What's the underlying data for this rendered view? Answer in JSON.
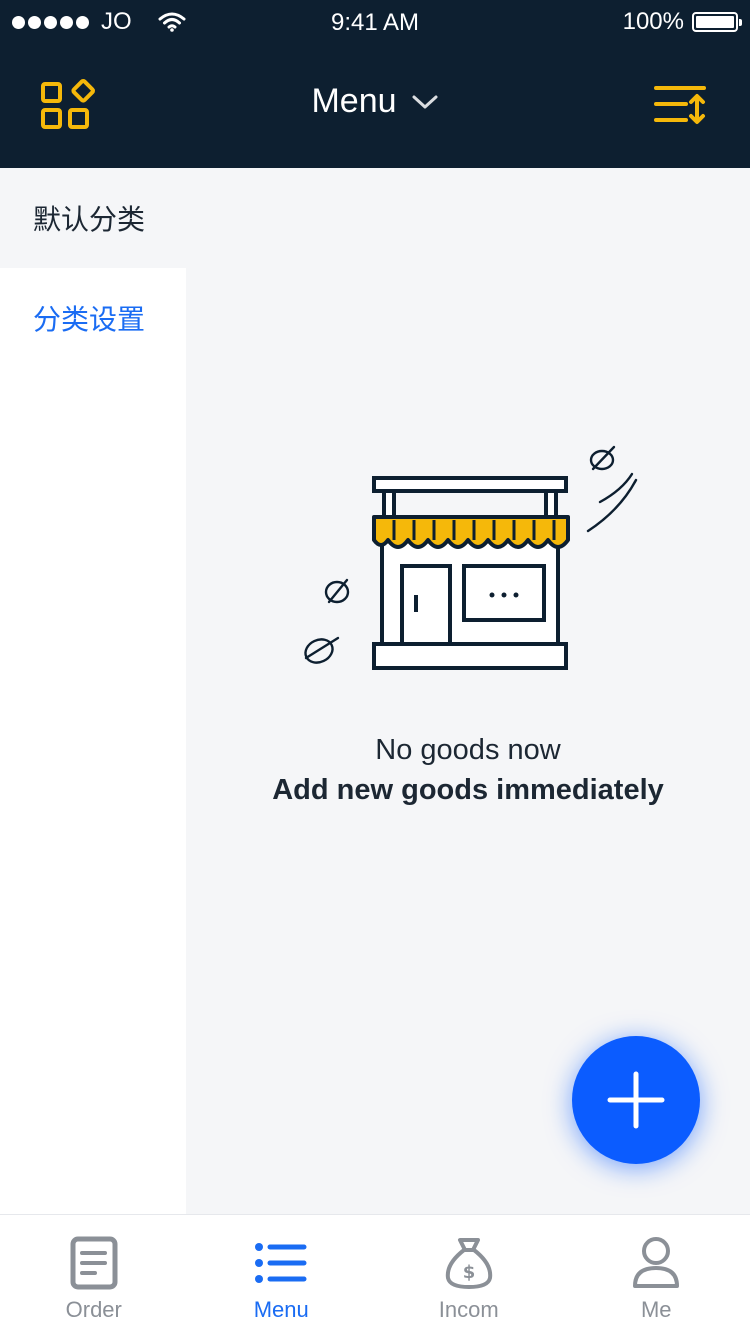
{
  "status_bar": {
    "carrier": "JO",
    "time": "9:41 AM",
    "battery": "100%"
  },
  "nav": {
    "title": "Menu",
    "left_icon": "grid-icon",
    "right_icon": "sort-icon"
  },
  "sidebar": {
    "items": [
      {
        "label": "默认分类",
        "state": "default"
      },
      {
        "label": "分类设置",
        "state": "link"
      }
    ]
  },
  "empty_state": {
    "line1": "No goods now",
    "line2": "Add new goods immediately",
    "illustration": "storefront-icon"
  },
  "fab": {
    "icon": "plus-icon"
  },
  "tabs": [
    {
      "label": "Order",
      "icon": "order-icon",
      "active": false
    },
    {
      "label": "Menu",
      "icon": "menu-list-icon",
      "active": true
    },
    {
      "label": "Incom",
      "icon": "money-bag-icon",
      "active": false
    },
    {
      "label": "Me",
      "icon": "person-icon",
      "active": false
    }
  ],
  "colors": {
    "header_bg": "#0d1f30",
    "accent_yellow": "#f5b80a",
    "primary_blue": "#1a6cf3",
    "fab_blue": "#0b5cff",
    "page_bg": "#f5f6f8"
  }
}
